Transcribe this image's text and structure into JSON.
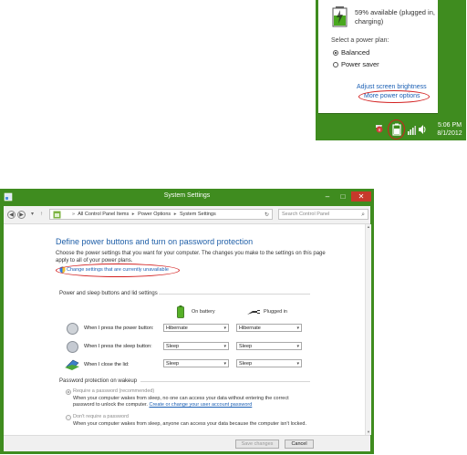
{
  "flyout": {
    "battery_status": "59% available (plugged in, charging)",
    "plan_title": "Select a power plan:",
    "plans": [
      {
        "label": "Balanced",
        "selected": true
      },
      {
        "label": "Power saver",
        "selected": false
      }
    ],
    "adjust_brightness_link": "Adjust screen brightness",
    "more_power_options_link": "More power options",
    "clock_time": "5:06 PM",
    "clock_date": "8/1/2012",
    "accent_color": "#3f8c1f",
    "highlight_color": "#d32020"
  },
  "window": {
    "title": "System Settings",
    "controls": {
      "minimize": "–",
      "maximize": "□",
      "close": "✕"
    },
    "breadcrumbs": [
      "All Control Panel Items",
      "Power Options",
      "System Settings"
    ],
    "search_placeholder": "Search Control Panel",
    "heading": "Define power buttons and turn on password protection",
    "intro": "Choose the power settings that you want for your computer. The changes you make to the settings on this page apply to all of your power plans.",
    "change_link": "Change settings that are currently unavailable",
    "section_power_buttons": "Power and sleep buttons and lid settings",
    "col_on_battery": "On battery",
    "col_plugged_in": "Plugged in",
    "rows": [
      {
        "label": "When I press the power button:",
        "battery": "Hibernate",
        "plugged": "Hibernate"
      },
      {
        "label": "When I press the sleep button:",
        "battery": "Sleep",
        "plugged": "Sleep"
      },
      {
        "label": "When I close the lid:",
        "battery": "Sleep",
        "plugged": "Sleep"
      }
    ],
    "section_password": "Password protection on wakeup",
    "require_password": {
      "label": "Require a password (recommended)",
      "desc_before": "When your computer wakes from sleep, no one can access your data without entering the correct password to unlock the computer. ",
      "desc_link": "Create or change your user account password"
    },
    "no_password": {
      "label": "Don't require a password",
      "desc": "When your computer wakes from sleep, anyone can access your data because the computer isn't locked."
    },
    "save_button": "Save changes",
    "cancel_button": "Cancel"
  }
}
